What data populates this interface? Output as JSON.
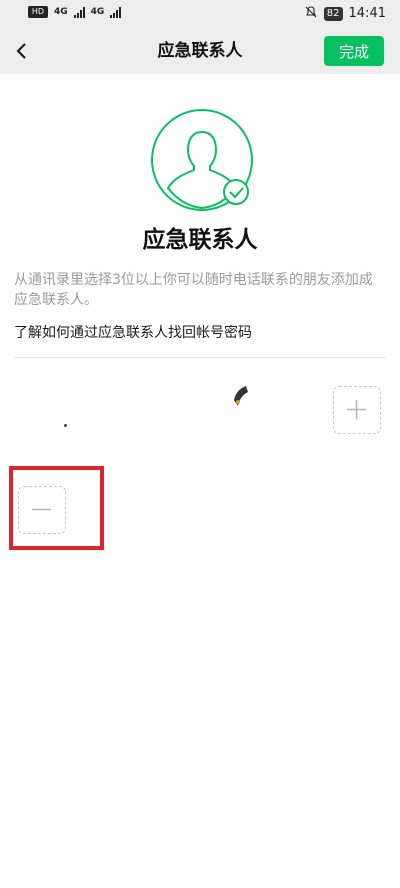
{
  "status_bar": {
    "left_badge": "HD",
    "signal_1": "4G",
    "signal_2": "4G",
    "battery": "82",
    "time": "14:41",
    "icons": [
      "hd-icon",
      "signal-icon",
      "mute-bell-icon",
      "battery-icon"
    ]
  },
  "nav": {
    "title": "应急联系人",
    "done_label": "完成",
    "back_icon": "chevron-left-icon"
  },
  "hero": {
    "title": "应急联系人",
    "avatar_icon": "person-check-icon",
    "accent_color": "#07c160"
  },
  "desc": "从通讯录里选择3位以上你可以随时电话联系的朋友添加成应急联系人。",
  "help_link": "了解如何通过应急联系人找回帐号密码",
  "actions": {
    "add_icon": "plus-icon",
    "remove_icon": "minus-icon"
  },
  "colors": {
    "nav_bg": "#ededed",
    "done_bg": "#07c160",
    "highlight": "#d9252c",
    "muted_text": "#9a9a9a"
  }
}
